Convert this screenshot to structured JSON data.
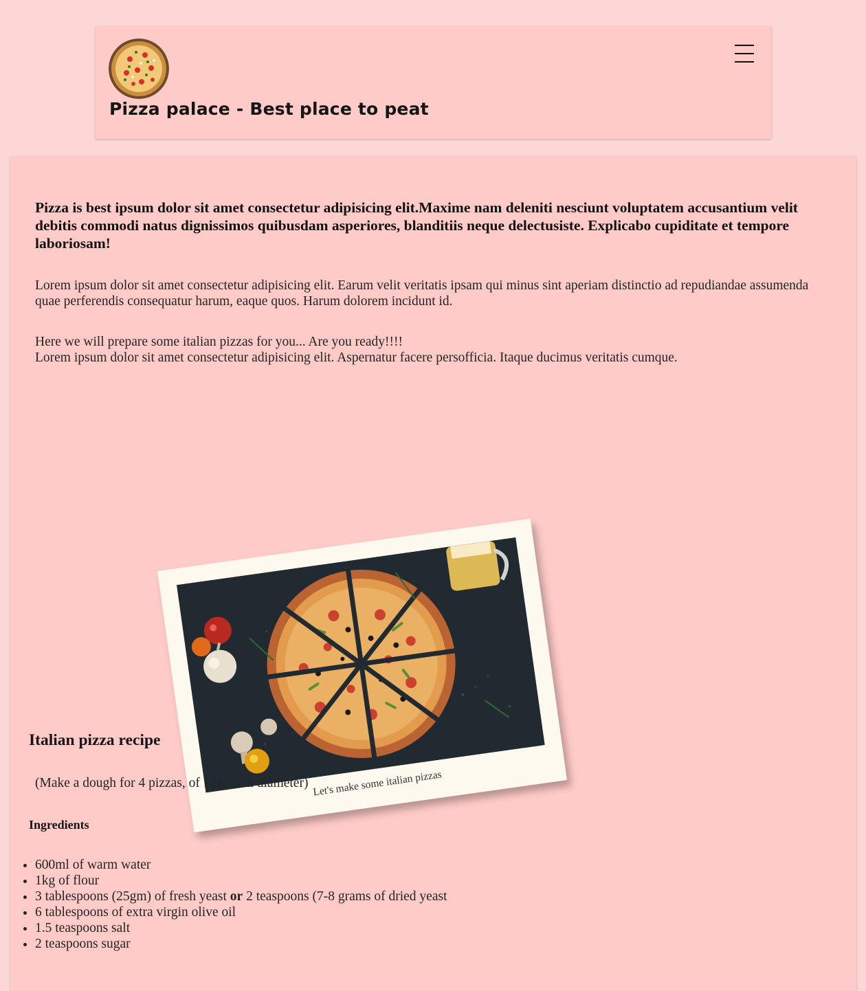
{
  "header": {
    "logo_icon": "pizza-logo-icon",
    "title": "Pizza palace - Best place to peat",
    "menu_icon": "hamburger-menu-icon"
  },
  "main": {
    "lead": "Pizza is best ipsum dolor sit amet consectetur adipisicing elit.Maxime nam deleniti nesciunt voluptatem accusantium velit debitis commodi natus dignissimos quibusdam asperiores, blanditiis neque delectusiste. Explicabo cupiditate et tempore laboriosam!",
    "paragraph_1": "Lorem ipsum dolor sit amet consectetur adipisicing elit. Earum velit veritatis ipsam qui minus sint aperiam distinctio ad repudiandae assumenda quae perferendis consequatur harum, eaque quos. Harum dolorem incidunt id.",
    "paragraph_2_line_1": "Here we will prepare some italian pizzas for you... Are you ready!!!!",
    "paragraph_2_line_2": "Lorem ipsum dolor sit amet consectetur adipisicing elit. Aspernatur facere persofficia. Itaque ducimus veritatis cumque.",
    "photo": {
      "subject": "sliced pizza on dark table with tomatoes, garlic, mushrooms, rosemary and beer",
      "caption": "Let's make some italian pizzas"
    },
    "recipe": {
      "title": "Italian pizza recipe",
      "note": "(Make a dough for 4 pizzas, of 12inch in diameter)",
      "ingredients_title": "Ingredients",
      "ingredients": [
        {
          "text": "600ml of warm water"
        },
        {
          "text": "1kg of flour"
        },
        {
          "before": "3 tablespoons (25gm) of fresh yeast ",
          "bold": "or",
          "after": " 2 teaspoons (7-8 grams of dried yeast"
        },
        {
          "text": "6 tablespoons of extra virgin olive oil"
        },
        {
          "text": "1.5 teaspoons salt"
        },
        {
          "text": "2 teaspoons sugar"
        }
      ]
    }
  },
  "colors": {
    "page_background": "#fcd7d5",
    "card_background": "#ffcbc8",
    "polaroid_background": "#fdf9ef"
  }
}
